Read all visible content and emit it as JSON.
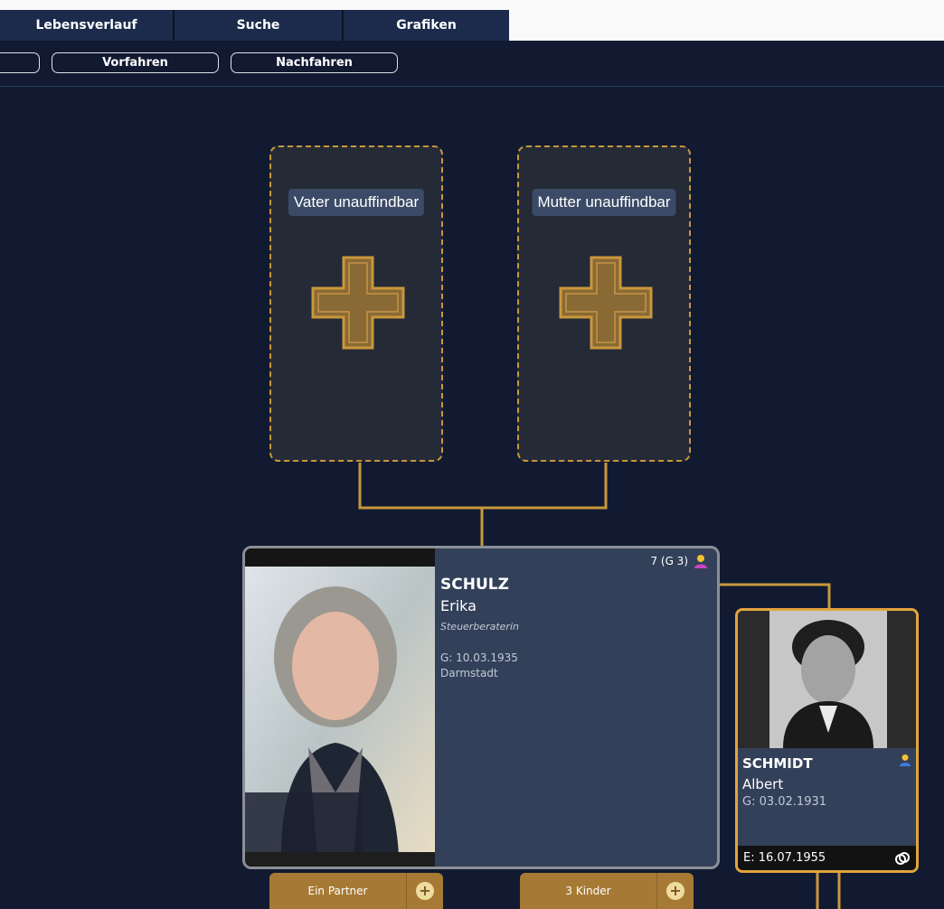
{
  "tabs": [
    {
      "label": "Lebensverlauf"
    },
    {
      "label": "Suche"
    },
    {
      "label": "Grafiken"
    }
  ],
  "subnav": {
    "ancestors_label": "Vorfahren",
    "descendants_label": "Nachfahren"
  },
  "placeholders": {
    "father": "Vater unauffindbar",
    "mother": "Mutter unauffindbar"
  },
  "main_person": {
    "count": "7 (G 3)",
    "surname": "SCHULZ",
    "firstname": "Erika",
    "occupation": "Steuerberaterin",
    "birth": "G: 10.03.1935",
    "place": "Darmstadt",
    "gender_icon": "person-female-icon"
  },
  "partner": {
    "surname": "SCHMIDT",
    "firstname": "Albert",
    "birth": "G: 03.02.1931",
    "marriage": "E: 16.07.1955",
    "gender_icon": "person-male-icon"
  },
  "buttons": {
    "partner_label": "Ein Partner",
    "children_label": "3 Kinder"
  },
  "colors": {
    "background": "#111a30",
    "accent": "#c9973c",
    "card": "#334059",
    "tab": "#1c2b4b"
  }
}
